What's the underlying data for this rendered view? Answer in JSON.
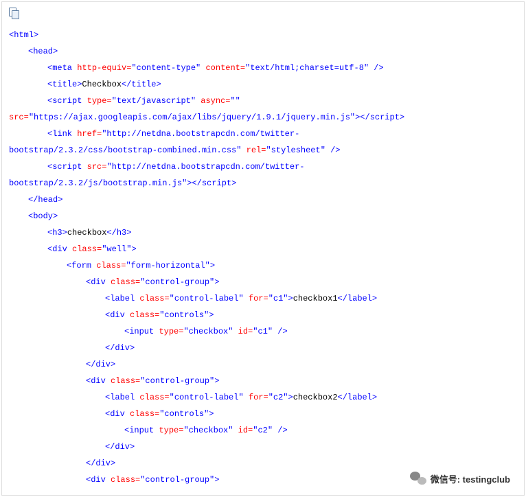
{
  "toolbar": {
    "copy_icon": "copy-icon"
  },
  "watermark": {
    "label": "微信号: testingclub"
  },
  "code": {
    "open_html": "<html>",
    "open_head": "<head>",
    "meta": {
      "tag_open": "<meta",
      "a1n": " http-equiv=",
      "a1v": "\"content-type\"",
      "a2n": " content=",
      "a2v": "\"text/html;charset=utf-8\"",
      "close": " />"
    },
    "title": {
      "open": "<title>",
      "text": "Checkbox",
      "close": "</title>"
    },
    "script1": {
      "open": "<script",
      "a1n": " type=",
      "a1v": "\"text/javascript\"",
      "a2n": " async=",
      "a2v": "\"\"",
      "brk": "",
      "a3n": "src=",
      "a3v": "\"https://ajax.googleapis.com/ajax/libs/jquery/1.9.1/jquery.min.js\"",
      "mid": ">",
      "close": "</script>"
    },
    "link": {
      "open": "<link",
      "a1n": " href=",
      "a1v1": "\"http://netdna.bootstrapcdn.com/twitter-",
      "a1v2": "bootstrap/2.3.2/css/bootstrap-combined.min.css\"",
      "a2n": " rel=",
      "a2v": "\"stylesheet\"",
      "close": " />"
    },
    "script2": {
      "open": "<script",
      "a1n": " src=",
      "a1v1": "\"http://netdna.bootstrapcdn.com/twitter-",
      "a1v2": "bootstrap/2.3.2/js/bootstrap.min.js\"",
      "mid": ">",
      "close": "</script>"
    },
    "close_head": "</head>",
    "open_body": "<body>",
    "h3": {
      "open": "<h3>",
      "text": "checkbox",
      "close": "</h3>"
    },
    "div_well": {
      "open": "<div",
      "an": " class=",
      "av": "\"well\"",
      "end": ">"
    },
    "form": {
      "open": "<form",
      "an": " class=",
      "av": "\"form-horizontal\"",
      "end": ">"
    },
    "cg": {
      "open": "<div",
      "an": " class=",
      "av": "\"control-group\"",
      "end": ">"
    },
    "lbl1": {
      "open": "<label",
      "a1n": " class=",
      "a1v": "\"control-label\"",
      "a2n": " for=",
      "a2v": "\"c1\"",
      "end": ">",
      "text": "checkbox1",
      "close": "</label>"
    },
    "ctrls": {
      "open": "<div",
      "an": " class=",
      "av": "\"controls\"",
      "end": ">"
    },
    "in1": {
      "open": "<input",
      "a1n": " type=",
      "a1v": "\"checkbox\"",
      "a2n": " id=",
      "a2v": "\"c1\"",
      "close": " />"
    },
    "close_div": "</div>",
    "lbl2": {
      "open": "<label",
      "a1n": " class=",
      "a1v": "\"control-label\"",
      "a2n": " for=",
      "a2v": "\"c2\"",
      "end": ">",
      "text": "checkbox2",
      "close": "</label>"
    },
    "in2": {
      "open": "<input",
      "a1n": " type=",
      "a1v": "\"checkbox\"",
      "a2n": " id=",
      "a2v": "\"c2\"",
      "close": " />"
    }
  }
}
